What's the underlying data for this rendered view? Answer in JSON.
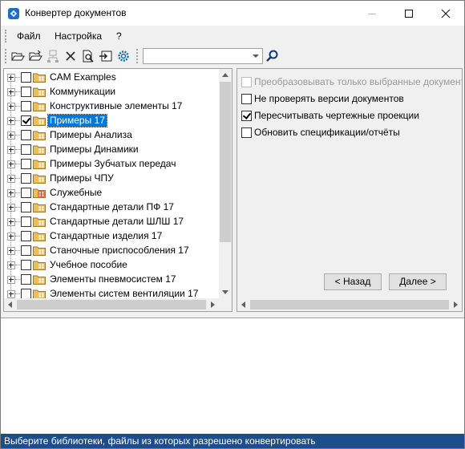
{
  "window": {
    "title": "Конвертер документов"
  },
  "menu": {
    "items": [
      "Файл",
      "Настройка",
      "?"
    ]
  },
  "toolbar": {
    "icons": [
      "open-folder-icon",
      "open-folder-alt-icon",
      "network-icon",
      "delete-icon",
      "preview-icon",
      "export-icon",
      "settings-gear-icon"
    ],
    "search_value": "",
    "search_icon": "search-icon"
  },
  "tree": {
    "items": [
      {
        "label": "CAM Examples",
        "checked": false,
        "selected": false,
        "folder": "normal"
      },
      {
        "label": "Коммуникации",
        "checked": false,
        "selected": false,
        "folder": "normal"
      },
      {
        "label": "Конструктивные элементы 17",
        "checked": false,
        "selected": false,
        "folder": "normal"
      },
      {
        "label": "Примеры 17",
        "checked": true,
        "selected": true,
        "folder": "normal"
      },
      {
        "label": "Примеры Анализа",
        "checked": false,
        "selected": false,
        "folder": "normal"
      },
      {
        "label": "Примеры Динамики",
        "checked": false,
        "selected": false,
        "folder": "normal"
      },
      {
        "label": "Примеры Зубчатых передач",
        "checked": false,
        "selected": false,
        "folder": "normal"
      },
      {
        "label": "Примеры ЧПУ",
        "checked": false,
        "selected": false,
        "folder": "normal"
      },
      {
        "label": "Служебные",
        "checked": false,
        "selected": false,
        "folder": "red"
      },
      {
        "label": "Стандартные детали ПФ 17",
        "checked": false,
        "selected": false,
        "folder": "normal"
      },
      {
        "label": "Стандартные детали ШЛШ 17",
        "checked": false,
        "selected": false,
        "folder": "normal"
      },
      {
        "label": "Стандартные изделия 17",
        "checked": false,
        "selected": false,
        "folder": "normal"
      },
      {
        "label": "Станочные приспособления 17",
        "checked": false,
        "selected": false,
        "folder": "normal"
      },
      {
        "label": "Учебное пособие",
        "checked": false,
        "selected": false,
        "folder": "normal"
      },
      {
        "label": "Элементы пневмосистем 17",
        "checked": false,
        "selected": false,
        "folder": "normal"
      },
      {
        "label": "Элементы систем вентиляции 17",
        "checked": false,
        "selected": false,
        "folder": "normal"
      }
    ]
  },
  "options": {
    "items": [
      {
        "label": "Преобразовывать только выбранные документы",
        "checked": false,
        "disabled": true
      },
      {
        "label": "Не проверять версии документов",
        "checked": false,
        "disabled": false
      },
      {
        "label": "Пересчитывать чертежные проекции",
        "checked": true,
        "disabled": false
      },
      {
        "label": "Обновить спецификации/отчёты",
        "checked": false,
        "disabled": false
      }
    ],
    "back_label": "< Назад",
    "next_label": "Далее >"
  },
  "status": {
    "text": "Выберите библиотеки, файлы из которых разрешено конвертировать"
  },
  "colors": {
    "status_bar": "#1e4d8c",
    "selection": "#0078d7",
    "folder": "#e8c15c",
    "folder_special": "#d9342b"
  }
}
